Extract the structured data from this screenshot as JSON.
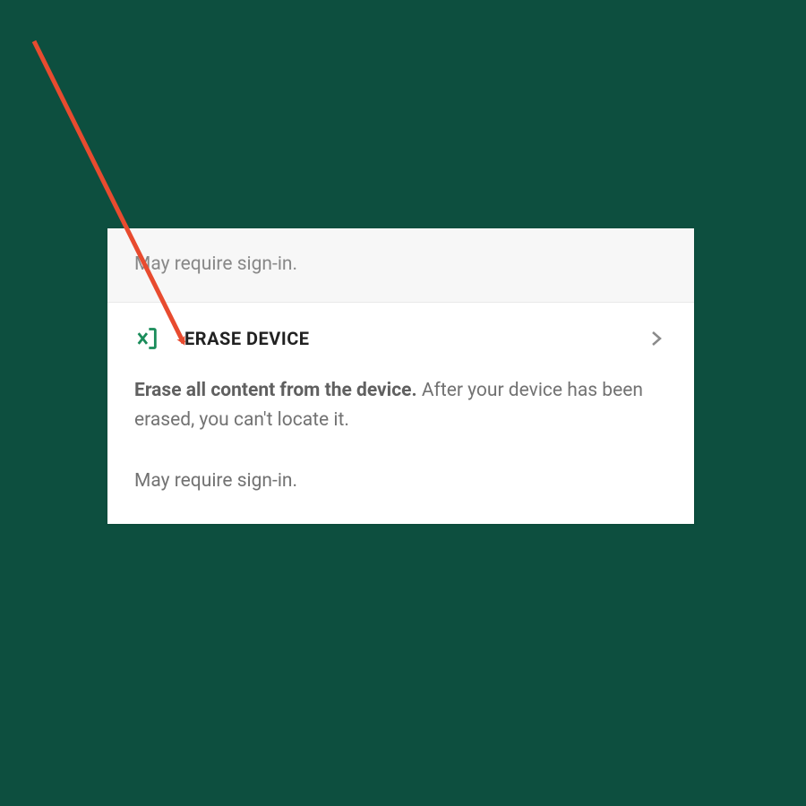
{
  "colors": {
    "background": "#0d4f3f",
    "accent_green": "#1a8c5a",
    "arrow_red": "#e84b2f"
  },
  "top": {
    "note": "May require sign-in."
  },
  "erase": {
    "title": "ERASE DEVICE",
    "desc_bold": "Erase all content from the device.",
    "desc_rest": " After your device has been erased, you can't locate it.",
    "signin_note": "May require sign-in."
  }
}
